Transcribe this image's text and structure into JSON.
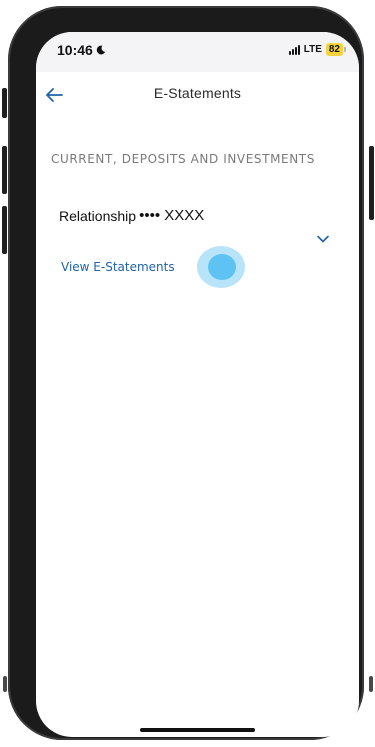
{
  "status_bar": {
    "time": "10:46",
    "network": "LTE",
    "battery": "82",
    "moon_icon": "moon-icon",
    "signal_icon": "signal-bars-icon"
  },
  "header": {
    "title": "E-Statements",
    "back_icon": "arrow-left-icon"
  },
  "section": {
    "title": "CURRENT, DEPOSITS AND INVESTMENTS"
  },
  "account": {
    "label": "Relationship",
    "masked_number": "•••• XXXX",
    "expand_icon": "chevron-down-icon",
    "view_link": "View E-Statements"
  },
  "colors": {
    "accent": "#1f63a8",
    "status_bar_bg": "#f4f4f6",
    "battery_badge": "#f4d43a",
    "tap_indicator": "#5ec2f3",
    "section_text": "#7a7a7a"
  }
}
